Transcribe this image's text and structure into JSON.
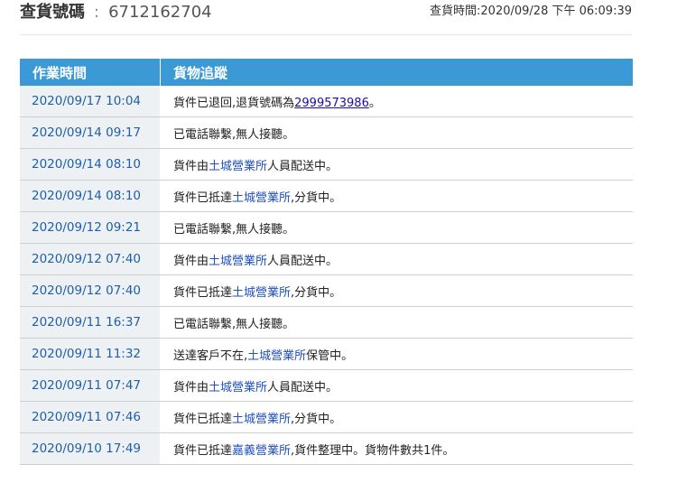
{
  "header": {
    "label": "查貨號碼",
    "separator": ":",
    "tracking_number": "6712162704",
    "query_time": "查貨時間:2020/09/28 下午 06:09:39"
  },
  "table": {
    "col_time": "作業時間",
    "col_status": "貨物追蹤",
    "rows": [
      {
        "time": "2020/09/17 10:04",
        "segments": [
          {
            "text": "貨件已退回,退貨號碼為"
          },
          {
            "text": "2999573986",
            "style": "link"
          },
          {
            "text": "。"
          }
        ]
      },
      {
        "time": "2020/09/14 09:17",
        "segments": [
          {
            "text": "已電話聯繫,無人接聽。"
          }
        ]
      },
      {
        "time": "2020/09/14 08:10",
        "segments": [
          {
            "text": "貨件由"
          },
          {
            "text": "土城營業所",
            "style": "office"
          },
          {
            "text": "人員配送中。"
          }
        ]
      },
      {
        "time": "2020/09/14 08:10",
        "segments": [
          {
            "text": "貨件已抵達"
          },
          {
            "text": "土城營業所",
            "style": "office"
          },
          {
            "text": ",分貨中。"
          }
        ]
      },
      {
        "time": "2020/09/12 09:21",
        "segments": [
          {
            "text": "已電話聯繫,無人接聽。"
          }
        ]
      },
      {
        "time": "2020/09/12 07:40",
        "segments": [
          {
            "text": "貨件由"
          },
          {
            "text": "土城營業所",
            "style": "office"
          },
          {
            "text": "人員配送中。"
          }
        ]
      },
      {
        "time": "2020/09/12 07:40",
        "segments": [
          {
            "text": "貨件已抵達"
          },
          {
            "text": "土城營業所",
            "style": "office"
          },
          {
            "text": ",分貨中。"
          }
        ]
      },
      {
        "time": "2020/09/11 16:37",
        "segments": [
          {
            "text": "已電話聯繫,無人接聽。"
          }
        ]
      },
      {
        "time": "2020/09/11 11:32",
        "segments": [
          {
            "text": "送達客戶不在,"
          },
          {
            "text": "土城營業所",
            "style": "office"
          },
          {
            "text": "保管中。"
          }
        ]
      },
      {
        "time": "2020/09/11 07:47",
        "segments": [
          {
            "text": "貨件由"
          },
          {
            "text": "土城營業所",
            "style": "office"
          },
          {
            "text": "人員配送中。"
          }
        ]
      },
      {
        "time": "2020/09/11 07:46",
        "segments": [
          {
            "text": "貨件已抵達"
          },
          {
            "text": "土城營業所",
            "style": "office"
          },
          {
            "text": ",分貨中。"
          }
        ]
      },
      {
        "time": "2020/09/10 17:49",
        "segments": [
          {
            "text": "貨件已抵達"
          },
          {
            "text": "嘉義營業所",
            "style": "office"
          },
          {
            "text": ",貨件整理中。貨物件數共1件。"
          }
        ]
      }
    ]
  },
  "colors": {
    "header_bg": "#3b9ad6",
    "time_text": "#1e5fa8",
    "time_cell_bg": "#eef1f3",
    "office_text": "#1f4fc2",
    "link_text": "#1a0dab"
  }
}
